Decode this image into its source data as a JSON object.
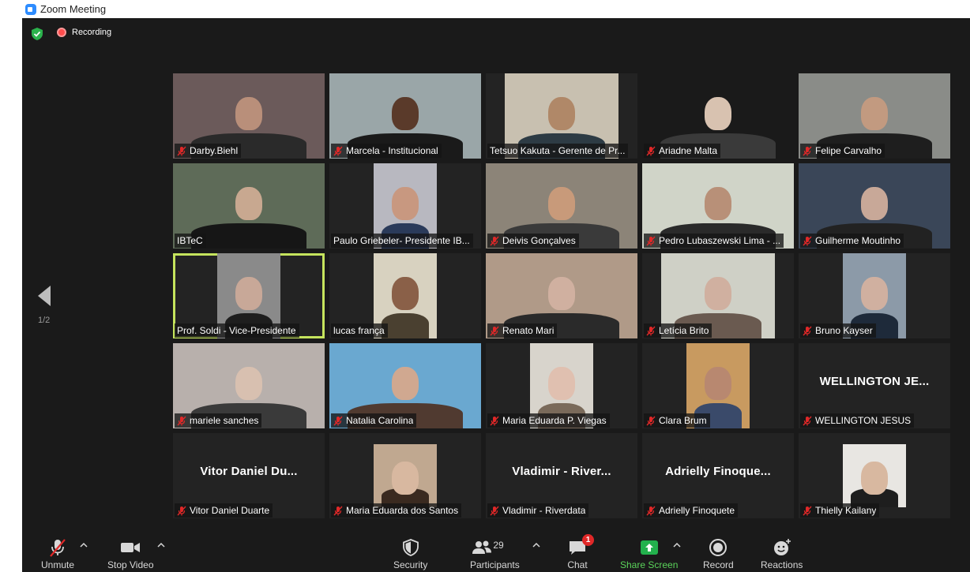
{
  "window": {
    "title": "Zoom Meeting"
  },
  "topbar": {
    "recording_label": "Recording"
  },
  "pagination": {
    "indicator": "1/2"
  },
  "participants": [
    {
      "name": "Darby.Biehl",
      "muted": true,
      "type": "video",
      "bg": "#6b5a5a",
      "skin": "#b98f7a",
      "shirt": "#2a2a2a",
      "layout": "full"
    },
    {
      "name": "Marcela - Institucional",
      "muted": true,
      "type": "video",
      "bg": "#9aa6a8",
      "skin": "#5a3a2a",
      "shirt": "#1a1a1a",
      "layout": "full"
    },
    {
      "name": "Tetsuo Kakuta - Gerente de Pr...",
      "muted": false,
      "type": "video",
      "bg": "#c8c0b0",
      "skin": "#b08868",
      "shirt": "#2d3b44",
      "layout": "wide"
    },
    {
      "name": "Ariadne Malta",
      "muted": true,
      "type": "video",
      "bg": "#1a1a1a",
      "skin": "#d8c2b0",
      "shirt": "#3a3a3a",
      "layout": "full"
    },
    {
      "name": "Felipe Carvalho",
      "muted": true,
      "type": "video",
      "bg": "#8a8c88",
      "skin": "#c29a80",
      "shirt": "#1e1e1e",
      "layout": "full"
    },
    {
      "name": "IBTeC",
      "muted": false,
      "type": "video",
      "bg": "#5e6b58",
      "skin": "#c8a890",
      "shirt": "#161616",
      "layout": "full"
    },
    {
      "name": "Paulo Griebeler- Presidente IB...",
      "muted": false,
      "type": "video",
      "bg": "#b8b8c0",
      "skin": "#c89880",
      "shirt": "#2a3a5a",
      "layout": "center"
    },
    {
      "name": "Deivis Gonçalves",
      "muted": true,
      "type": "video",
      "bg": "#8c8478",
      "skin": "#c89a7a",
      "shirt": "#3a3a3a",
      "layout": "full"
    },
    {
      "name": "Pedro Lubaszewski Lima - ...",
      "muted": true,
      "type": "video",
      "bg": "#d0d4c8",
      "skin": "#b89078",
      "shirt": "#2a2a2a",
      "layout": "full"
    },
    {
      "name": "Guilherme Moutinho",
      "muted": true,
      "type": "video",
      "bg": "#3a4658",
      "skin": "#c8a898",
      "shirt": "#222",
      "layout": "full"
    },
    {
      "name": "Prof. Soldi - Vice-Presidente",
      "muted": false,
      "type": "video",
      "bg": "#8a8a8a",
      "skin": "#c8a898",
      "shirt": "#1e1e1e",
      "layout": "center",
      "speaking": true
    },
    {
      "name": "lucas frança",
      "muted": false,
      "type": "video",
      "bg": "#d8d2c0",
      "skin": "#8a6048",
      "shirt": "#4a4030",
      "layout": "center"
    },
    {
      "name": "Renato Mari",
      "muted": true,
      "type": "video",
      "bg": "#b09a88",
      "skin": "#d0b0a0",
      "shirt": "#2a2a2a",
      "layout": "full"
    },
    {
      "name": "Letícia Brito",
      "muted": true,
      "type": "video",
      "bg": "#cfd0c6",
      "skin": "#d0b0a0",
      "shirt": "#6a5a50",
      "layout": "wide"
    },
    {
      "name": "Bruno Kayser",
      "muted": true,
      "type": "video",
      "bg": "#8c9aa8",
      "skin": "#d0b0a0",
      "shirt": "#1e2a3a",
      "layout": "center"
    },
    {
      "name": "mariele sanches",
      "muted": true,
      "type": "video",
      "bg": "#b8b0ac",
      "skin": "#d8c0b0",
      "shirt": "#3a3a3a",
      "layout": "full"
    },
    {
      "name": "Natalia Carolina",
      "muted": true,
      "type": "video",
      "bg": "#6aa8d0",
      "skin": "#d0a890",
      "shirt": "#503a30",
      "layout": "full"
    },
    {
      "name": "Maria Eduarda P. Viegas",
      "muted": true,
      "type": "video",
      "bg": "#d8d4cc",
      "skin": "#e0c0b0",
      "shirt": "#7a6a5a",
      "layout": "center"
    },
    {
      "name": "Clara Brum",
      "muted": true,
      "type": "video",
      "bg": "#c89a60",
      "skin": "#b88870",
      "shirt": "#3a4a6a",
      "layout": "center"
    },
    {
      "name": "WELLINGTON JESUS",
      "muted": true,
      "type": "name",
      "display": "WELLINGTON JE...",
      "layout": "full"
    },
    {
      "name": "Vitor Daniel Duarte",
      "muted": true,
      "type": "name",
      "display": "Vitor Daniel Du...",
      "layout": "full"
    },
    {
      "name": "Maria Eduarda dos Santos",
      "muted": true,
      "type": "video",
      "bg": "#c0a890",
      "skin": "#d8b8a0",
      "shirt": "#3a2a20",
      "layout": "crop"
    },
    {
      "name": "Vladimir - Riverdata",
      "muted": true,
      "type": "name",
      "display": "Vladimir - River...",
      "layout": "full"
    },
    {
      "name": "Adrielly Finoquete",
      "muted": true,
      "type": "name",
      "display": "Adrielly Finoque...",
      "layout": "full"
    },
    {
      "name": "Thielly Kailany",
      "muted": true,
      "type": "video",
      "bg": "#e8e6e2",
      "skin": "#d8b8a0",
      "shirt": "#1e1e1e",
      "layout": "crop"
    }
  ],
  "toolbar": {
    "unmute": "Unmute",
    "stop_video": "Stop Video",
    "security": "Security",
    "participants": "Participants",
    "participants_count": "29",
    "chat": "Chat",
    "chat_badge": "1",
    "share_screen": "Share Screen",
    "record": "Record",
    "reactions": "Reactions"
  },
  "colors": {
    "active_speaker": "#c5e45d",
    "share_green": "#5ad35a",
    "muted_red": "#e02828"
  }
}
